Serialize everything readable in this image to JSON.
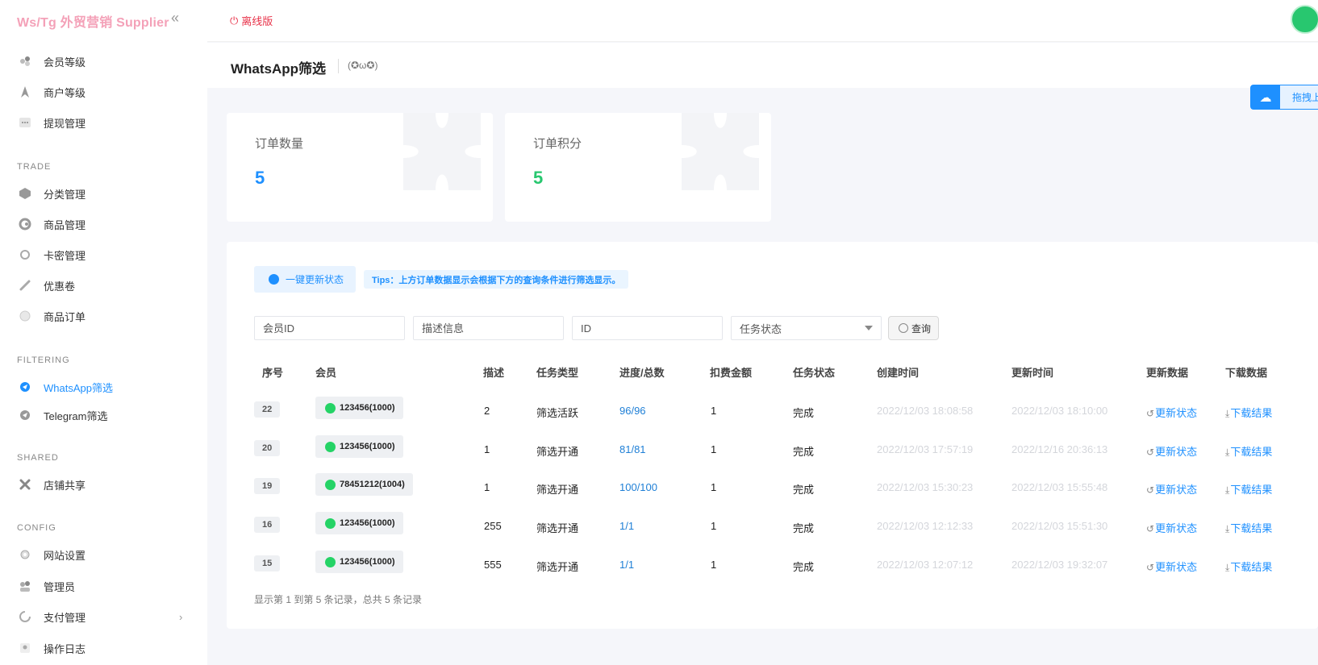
{
  "brand": "Ws/Tg 外贸营销 Supplier",
  "topbar": {
    "offline_label": "离线版"
  },
  "sidebar": {
    "items_top": [
      {
        "label": "会员等级",
        "icon": "members-icon"
      },
      {
        "label": "商户等级",
        "icon": "rocket-icon"
      },
      {
        "label": "提现管理",
        "icon": "dots-icon"
      }
    ],
    "sections": {
      "trade": "TRADE",
      "filtering": "FILTERING",
      "shared": "SHARED",
      "config": "CONFIG"
    },
    "trade_items": [
      {
        "label": "分类管理",
        "icon": "cube-icon"
      },
      {
        "label": "商品管理",
        "icon": "refresh-icon"
      },
      {
        "label": "卡密管理",
        "icon": "gear-icon"
      },
      {
        "label": "优惠卷",
        "icon": "link-icon"
      },
      {
        "label": "商品订单",
        "icon": "globe-icon"
      }
    ],
    "filtering_items": [
      {
        "label": "WhatsApp筛选",
        "icon": "telegram-icon",
        "active": true
      },
      {
        "label": "Telegram筛选",
        "icon": "telegram-icon",
        "active": false
      }
    ],
    "shared_items": [
      {
        "label": "店铺共享",
        "icon": "cross-icon"
      }
    ],
    "config_items": [
      {
        "label": "网站设置",
        "icon": "gear-icon"
      },
      {
        "label": "管理员",
        "icon": "users-icon"
      },
      {
        "label": "支付管理",
        "icon": "pie-icon",
        "has_arrow": true
      },
      {
        "label": "操作日志",
        "icon": "user-icon"
      }
    ]
  },
  "titlebar": {
    "title": "WhatsApp筛选",
    "face": "(✪ω✪)"
  },
  "float_button": {
    "label": "拖拽上"
  },
  "stats": [
    {
      "label": "订单数量",
      "value": "5",
      "color": "#1e90ff"
    },
    {
      "label": "订单积分",
      "value": "5",
      "color": "#28c76f"
    }
  ],
  "toolbar": {
    "update_all": "一键更新状态",
    "tips": "Tips：上方订单数据显示会根据下方的查询条件进行筛选显示。"
  },
  "filters": {
    "member_id_placeholder": "会员ID",
    "desc_placeholder": "描述信息",
    "id_placeholder": "ID",
    "status_placeholder": "任务状态",
    "query_label": "查询"
  },
  "table": {
    "columns": [
      "序号",
      "会员",
      "描述",
      "任务类型",
      "进度/总数",
      "扣费金额",
      "任务状态",
      "创建时间",
      "更新时间",
      "更新数据",
      "下载数据"
    ],
    "rows": [
      {
        "id": "22",
        "member": "123456(1000)",
        "desc": "2",
        "type": "筛选活跃",
        "progress": "96/96",
        "fee": "1",
        "status": "完成",
        "created": "2022/12/03 18:08:58",
        "updated": "2022/12/03 18:10:00",
        "update_link": "更新状态",
        "download_link": "下载结果"
      },
      {
        "id": "20",
        "member": "123456(1000)",
        "desc": "1",
        "type": "筛选开通",
        "progress": "81/81",
        "fee": "1",
        "status": "完成",
        "created": "2022/12/03 17:57:19",
        "updated": "2022/12/16 20:36:13",
        "update_link": "更新状态",
        "download_link": "下载结果"
      },
      {
        "id": "19",
        "member": "78451212(1004)",
        "desc": "1",
        "type": "筛选开通",
        "progress": "100/100",
        "fee": "1",
        "status": "完成",
        "created": "2022/12/03 15:30:23",
        "updated": "2022/12/03 15:55:48",
        "update_link": "更新状态",
        "download_link": "下载结果"
      },
      {
        "id": "16",
        "member": "123456(1000)",
        "desc": "255",
        "type": "筛选开通",
        "progress": "1/1",
        "fee": "1",
        "status": "完成",
        "created": "2022/12/03 12:12:33",
        "updated": "2022/12/03 15:51:30",
        "update_link": "更新状态",
        "download_link": "下载结果"
      },
      {
        "id": "15",
        "member": "123456(1000)",
        "desc": "555",
        "type": "筛选开通",
        "progress": "1/1",
        "fee": "1",
        "status": "完成",
        "created": "2022/12/03 12:07:12",
        "updated": "2022/12/03 19:32:07",
        "update_link": "更新状态",
        "download_link": "下载结果"
      }
    ],
    "footer": "显示第 1 到第 5 条记录，总共 5 条记录"
  }
}
